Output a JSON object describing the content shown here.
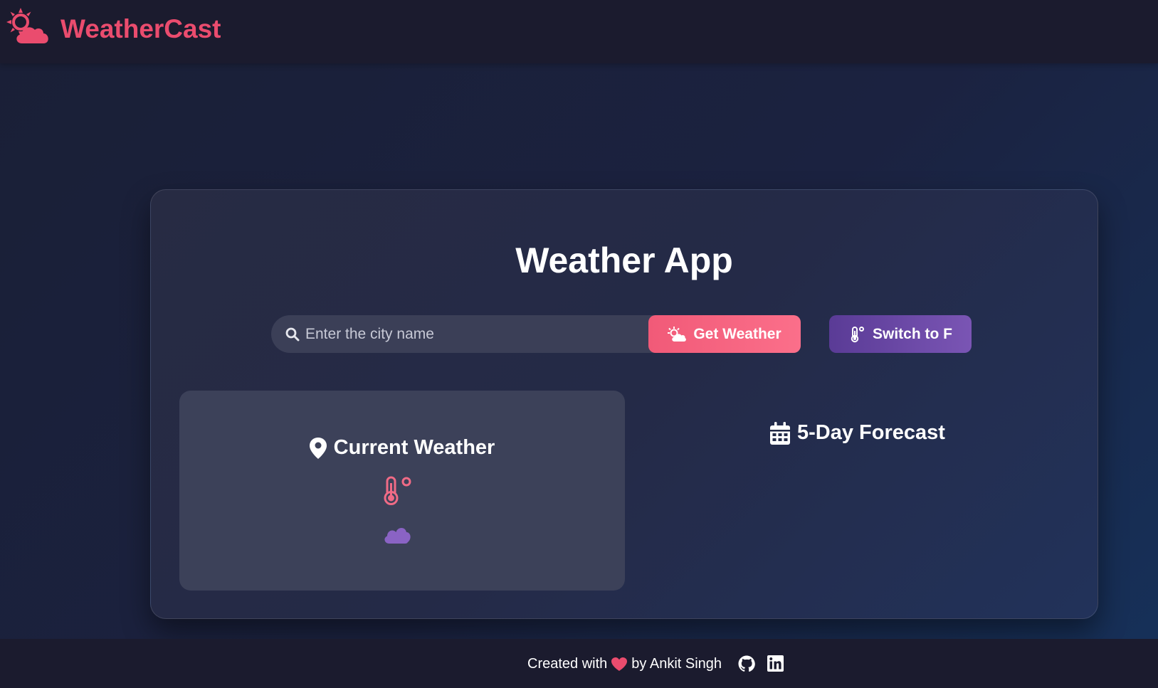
{
  "header": {
    "brand_name": "WeatherCast",
    "logo_icon": "sun-cloud-icon",
    "brand_color": "#ea4c6e"
  },
  "main": {
    "title": "Weather App",
    "search": {
      "placeholder": "Enter the city name",
      "value": ""
    },
    "get_weather_label": "Get Weather",
    "switch_unit_label": "Switch to F",
    "current_weather": {
      "heading": "Current Weather",
      "icons": [
        "location-pin-icon",
        "thermometer-icon",
        "cloud-icon"
      ]
    },
    "forecast": {
      "heading": "5-Day Forecast",
      "icon": "calendar-icon"
    }
  },
  "footer": {
    "credit_prefix": "Created with",
    "credit_suffix": "by Ankit Singh",
    "links": [
      "github-icon",
      "linkedin-icon"
    ]
  },
  "colors": {
    "accent_pink": "#f15a78",
    "accent_purple": "#6a48a6",
    "bar_background": "#1b1b2e"
  }
}
